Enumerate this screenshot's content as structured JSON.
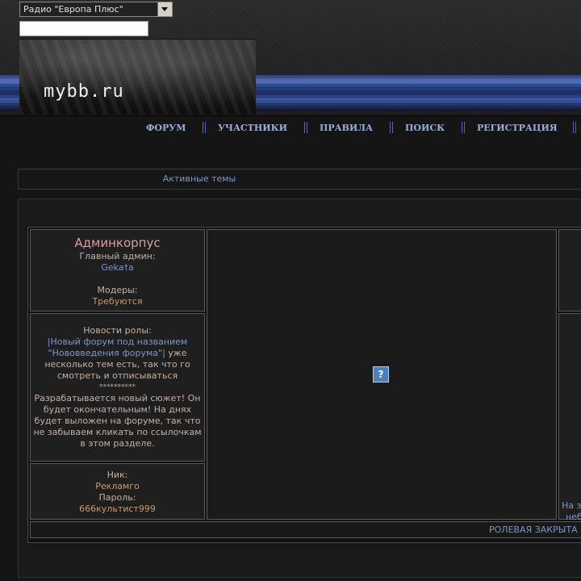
{
  "header": {
    "radio_select_value": "Радио \"Европа Плюс\"",
    "search_value": "",
    "logo_text": "mybb.ru"
  },
  "nav": {
    "items": [
      "ФОРУМ",
      "УЧАСТНИКИ",
      "ПРАВИЛА",
      "ПОИСК",
      "РЕГИСТРАЦИЯ"
    ]
  },
  "active_topics": {
    "label": "Активные темы"
  },
  "admin_block": {
    "title": "Админкорпус",
    "main_admin_label": "Главный админ:",
    "main_admin_name": "Geka†a",
    "moders_label": "Модеры:",
    "moders_value": "Требуются"
  },
  "news_block": {
    "title": "Новости ролы:",
    "link_text": "|Новый форум под названием \"Нововведения форума\"|",
    "link_followup": " уже несколько тем есть, так что го смотреть и отписываться",
    "separator": "**********",
    "body": "Разрабатывается новый сюжет! Он будет окончательным! На днях будет выложен на форуме, так что не забываем кликать по ссылочкам в этом разделе."
  },
  "ad_block": {
    "nick_label": "Ник:",
    "nick_value": "Рекламго",
    "password_label": "Пароль:",
    "password_value": "666культист999"
  },
  "center_image": {
    "glyph": "?"
  },
  "right_column": {
    "partial_line1": "На з",
    "partial_line2": "неб"
  },
  "footer": {
    "text": "РОЛЕВАЯ ЗАКРЫТА Н"
  },
  "colors": {
    "background": "#151515",
    "link_blue": "#7f95c9",
    "nav_blue": "#9aaee0",
    "accent_orange": "#cc9966",
    "title_pink": "#d9a0a0"
  }
}
